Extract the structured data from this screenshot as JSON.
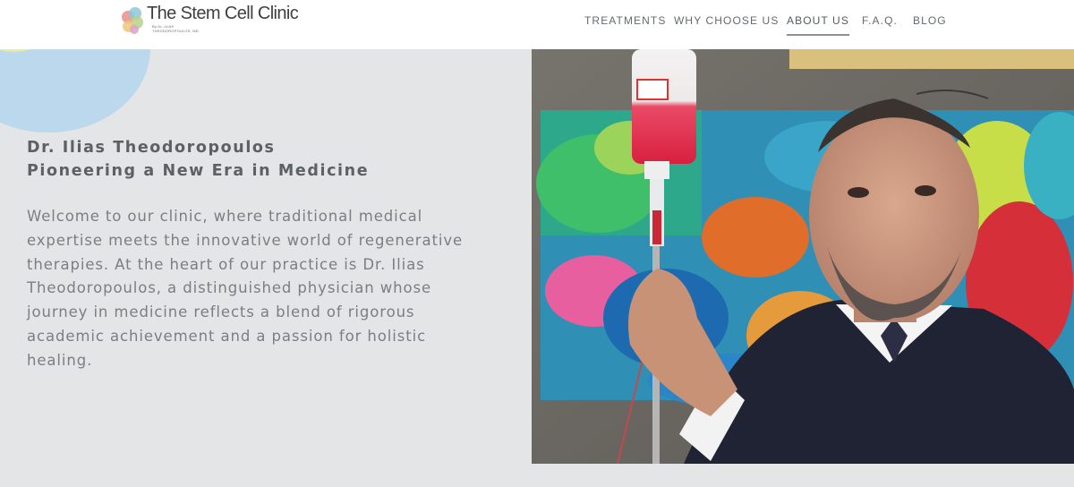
{
  "logo": {
    "name": "The Stem Cell Clinic",
    "sub_line1": "By Dr. ILIAS",
    "sub_line2": "THEODOROPOULOS, MD"
  },
  "nav": [
    {
      "label": "TREATMENTS",
      "active": false
    },
    {
      "label": "WHY CHOOSE US",
      "active": false
    },
    {
      "label": "ABOUT US",
      "active": true
    },
    {
      "label": "F.A.Q.",
      "active": false
    },
    {
      "label": "BLOG",
      "active": false
    }
  ],
  "hero": {
    "title_line1": "Dr. Ilias Theodoropoulos",
    "title_line2": "Pioneering a New Era in Medicine",
    "body_lines": [
      "Welcome to our clinic, where traditional medical",
      "expertise meets the innovative world of regenerative",
      "therapies. At the heart of our practice is Dr. Ilias",
      "Theodoropoulos, a distinguished physician whose",
      "journey in medicine reflects a blend of rigorous",
      "academic achievement and a passion for holistic",
      "healing."
    ]
  },
  "colors": {
    "page_bg": "#e4e5e6",
    "header_bg": "#ffffff",
    "title": "#5c6163",
    "body": "#7a7f82",
    "deco_blue": "#bcd8ec",
    "deco_yellow": "#e9ec9f"
  },
  "photo": {
    "icon": "doctor-holding-iv-bag-photo"
  }
}
